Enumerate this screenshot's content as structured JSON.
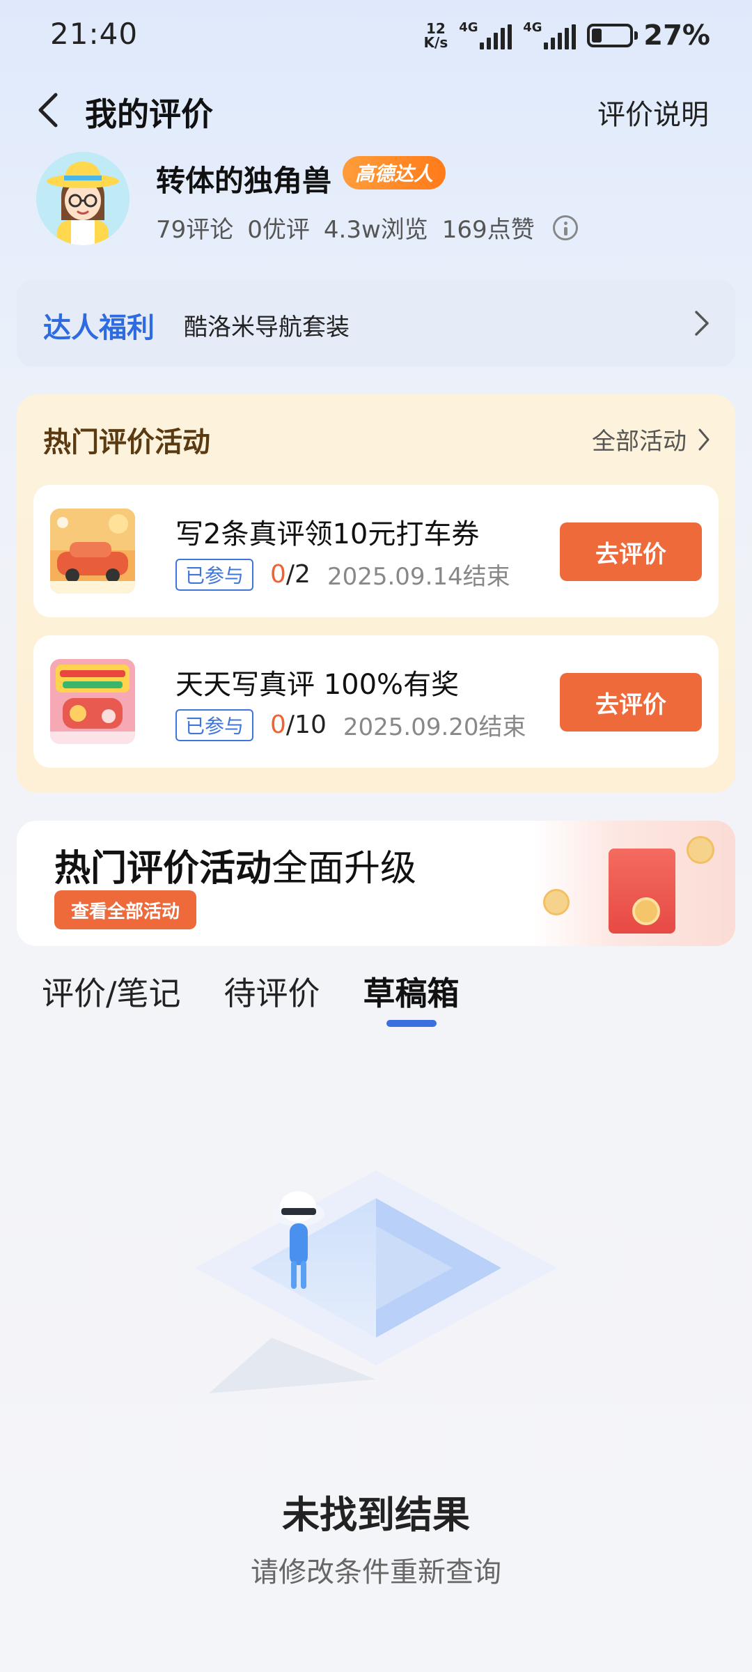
{
  "status_bar": {
    "time": "21:40",
    "net_speed_value": "12",
    "net_speed_unit": "K/s",
    "signal1_label": "4G",
    "signal2_label": "4G",
    "battery_percent": "27%",
    "battery_level": 0.27
  },
  "header": {
    "title": "我的评价",
    "rules_link": "评价说明"
  },
  "profile": {
    "name": "转体的独角兽",
    "badge": "高德达人",
    "stats": [
      "79评论",
      "0优评",
      "4.3w浏览",
      "169点赞"
    ]
  },
  "perks": {
    "title": "达人福利",
    "text": "酷洛米导航套装"
  },
  "activities": {
    "title": "热门评价活动",
    "all_link": "全部活动",
    "items": [
      {
        "title": "写2条真评领10元打车券",
        "joined": "已参与",
        "progress_current": "0",
        "progress_total": "/2",
        "deadline": "2025.09.14结束",
        "button": "去评价"
      },
      {
        "title": "天天写真评 100%有奖",
        "joined": "已参与",
        "progress_current": "0",
        "progress_total": "/10",
        "deadline": "2025.09.20结束",
        "button": "去评价"
      }
    ]
  },
  "banner": {
    "title_bold": "热门评价活动",
    "title_rest": "全面升级",
    "button": "查看全部活动"
  },
  "tabs": [
    {
      "label": "评价/笔记",
      "active": false
    },
    {
      "label": "待评价",
      "active": false
    },
    {
      "label": "草稿箱",
      "active": true
    }
  ],
  "empty_state": {
    "title": "未找到结果",
    "subtitle": "请修改条件重新查询"
  },
  "colors": {
    "accent_blue": "#3a6fe0",
    "action_orange": "#ee6a3b",
    "badge_orange": "#ff8a26"
  }
}
